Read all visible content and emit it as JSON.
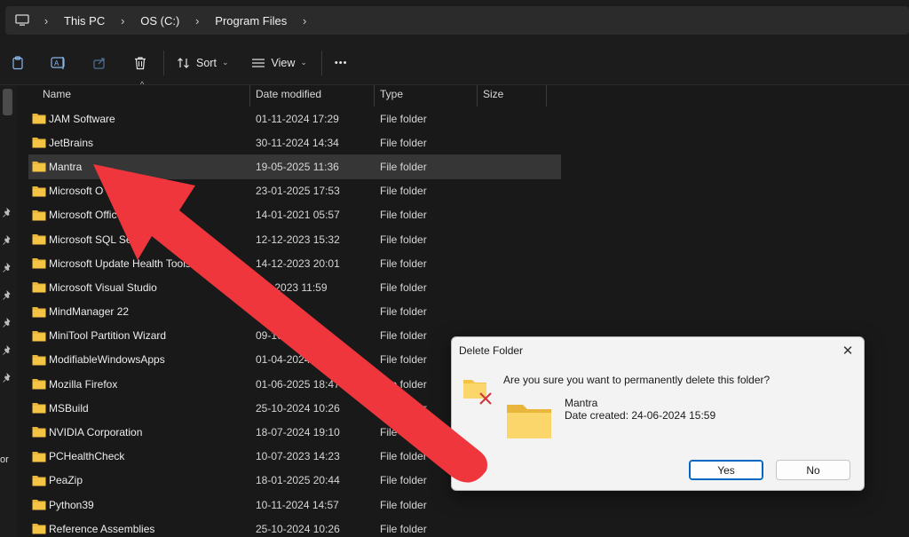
{
  "address_bar": {
    "breadcrumbs": [
      "This PC",
      "OS (C:)",
      "Program Files"
    ]
  },
  "toolbar": {
    "sort_label": "Sort",
    "view_label": "View",
    "more_label": "•••"
  },
  "sidebar": {
    "partial_text": "or"
  },
  "columns": {
    "name": "Name",
    "date": "Date modified",
    "type": "Type",
    "size": "Size"
  },
  "files": [
    {
      "name": "JAM Software",
      "date": "01-11-2024 17:29",
      "type": "File folder"
    },
    {
      "name": "JetBrains",
      "date": "30-11-2024 14:34",
      "type": "File folder"
    },
    {
      "name": "Mantra",
      "date": "19-05-2025 11:36",
      "type": "File folder"
    },
    {
      "name": "Microsoft O",
      "date": "23-01-2025 17:53",
      "type": "File folder"
    },
    {
      "name": "Microsoft Offic",
      "date": "14-01-2021 05:57",
      "type": "File folder"
    },
    {
      "name": "Microsoft SQL Se",
      "date": "12-12-2023 15:32",
      "type": "File folder"
    },
    {
      "name": "Microsoft Update Health Tools",
      "date": "14-12-2023 20:01",
      "type": "File folder"
    },
    {
      "name": "Microsoft Visual Studio",
      "date": "-12-2023 11:59",
      "type": "File folder"
    },
    {
      "name": "MindManager 22",
      "date": "4 14:56",
      "type": "File folder"
    },
    {
      "name": "MiniTool Partition Wizard",
      "date": "09-10-",
      "type": "File folder"
    },
    {
      "name": "ModifiableWindowsApps",
      "date": "01-04-2024 1",
      "type": "File folder"
    },
    {
      "name": "Mozilla Firefox",
      "date": "01-06-2025 18:47",
      "type": "File folder"
    },
    {
      "name": "MSBuild",
      "date": "25-10-2024 10:26",
      "type": "File folder"
    },
    {
      "name": "NVIDIA Corporation",
      "date": "18-07-2024 19:10",
      "type": "File fo"
    },
    {
      "name": "PCHealthCheck",
      "date": "10-07-2023 14:23",
      "type": "File folder"
    },
    {
      "name": "PeaZip",
      "date": "18-01-2025 20:44",
      "type": "File folder"
    },
    {
      "name": "Python39",
      "date": "10-11-2024 14:57",
      "type": "File folder"
    },
    {
      "name": "Reference Assemblies",
      "date": "25-10-2024 10:26",
      "type": "File folder"
    }
  ],
  "selected_index": 2,
  "dialog": {
    "title": "Delete Folder",
    "close_label": "✕",
    "question": "Are you sure you want to permanently delete this folder?",
    "folder_name": "Mantra",
    "date_created": "Date created: 24-06-2024 15:59",
    "yes_label": "Yes",
    "no_label": "No"
  },
  "colors": {
    "arrow": "#f0363d",
    "folder_yellow": "#f6c445",
    "accent_blue": "#0067c0"
  }
}
